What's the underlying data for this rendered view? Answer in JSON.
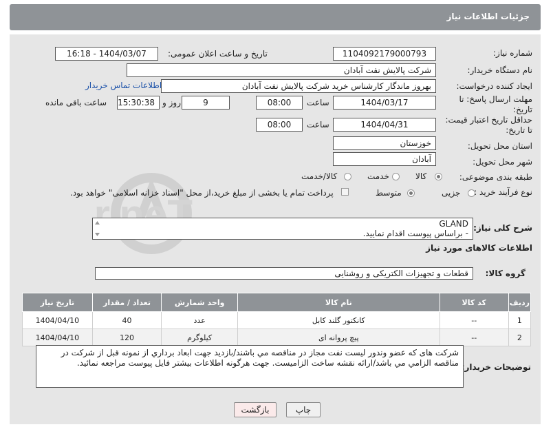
{
  "header": {
    "title": "جزئیات اطلاعات نیاز"
  },
  "fields": {
    "need_number_label": "شماره نیاز:",
    "need_number": "1104092179000793",
    "announce_label": "تاریخ و ساعت اعلان عمومی:",
    "announce_value": "1404/03/07 - 16:18",
    "buyer_label": "نام دستگاه خریدار:",
    "buyer_value": "شرکت پالایش نفت آبادان",
    "creator_label": "ایجاد کننده درخواست:",
    "creator_value": "بهروز ماندگار کارشناس خرید شرکت پالایش نفت آبادان",
    "contact_link": "اطلاعات تماس خریدار",
    "deadline_label_1": "مهلت ارسال پاسخ: تا",
    "deadline_label_2": "تاریخ:",
    "deadline_date": "1404/03/17",
    "time_label": "ساعت",
    "deadline_time": "08:00",
    "days_value": "9",
    "days_label": "روز و",
    "remaining_time": "15:30:38",
    "remaining_label": "ساعت باقی مانده",
    "price_label_1": "حداقل تاریخ اعتبار قیمت:",
    "price_label_2": "تا تاریخ:",
    "price_date": "1404/04/31",
    "price_time": "08:00",
    "province_label": "استان محل تحویل:",
    "province_value": "خوزستان",
    "city_label": "شهر محل تحویل:",
    "city_value": "آبادان",
    "category_label": "طبقه بندی موضوعی:",
    "category_options": [
      "کالا",
      "خدمت",
      "کالا/خدمت"
    ],
    "process_label": "نوع فرآیند خرید :",
    "process_options": [
      "جزیی",
      "متوسط"
    ],
    "payment_note": "پرداخت تمام یا بخشی از مبلغ خرید،از محل \"اسناد خزانه اسلامی\" خواهد بود."
  },
  "description": {
    "label": "شرح کلی نیاز:",
    "line1": "GLAND",
    "line2": "- براساس پیوست اقدام نمایید."
  },
  "goods": {
    "section_title": "اطلاعات کالاهای مورد نیاز",
    "group_label": "گروه کالا:",
    "group_value": "قطعات و تجهیزات الکتریکی و روشنایی",
    "columns": [
      "ردیف",
      "کد کالا",
      "نام کالا",
      "واحد شمارش",
      "تعداد / مقدار",
      "تاریخ نیاز"
    ],
    "rows": [
      {
        "row": "1",
        "code": "--",
        "name": "کانکتور گلند کابل",
        "unit": "عدد",
        "qty": "40",
        "date": "1404/04/10"
      },
      {
        "row": "2",
        "code": "--",
        "name": "پیچ پروانه ای",
        "unit": "کیلوگرم",
        "qty": "120",
        "date": "1404/04/10"
      }
    ]
  },
  "buyer_notes": {
    "label": "توضیحات خریدار:",
    "text": "شرکت های که عضو وندور لیست نفت مجاز در مناقصه مي باشند/بازديد جهت ابعاد برداري از نمونه قبل از شركت در مناقصه الزامي مي باشد/ارائه نقشه ساخت الزاميست. جهت هرگونه اطلاعات بيشتر فايل پيوست مراجعه نمائيد."
  },
  "buttons": {
    "print": "چاپ",
    "back": "بازگشت"
  },
  "watermark": "AriaTender.neT",
  "colors": {
    "header": "#8f9397",
    "panel": "#e6e6e6",
    "link": "#1a50a8"
  }
}
